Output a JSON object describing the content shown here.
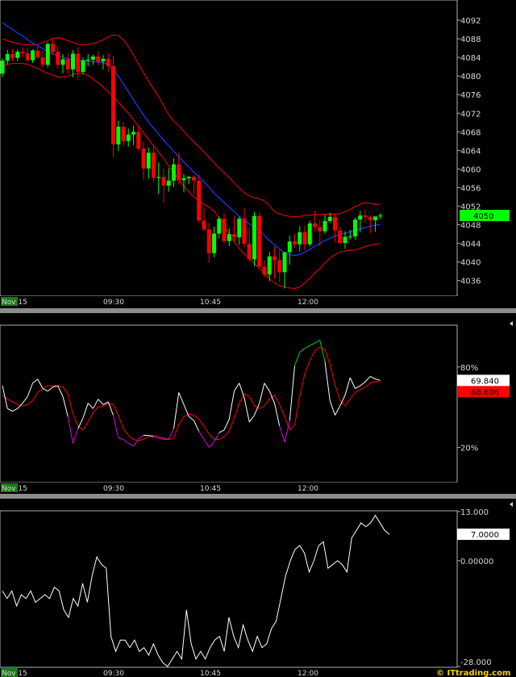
{
  "time_axis": {
    "date_badge": "Nov 15",
    "labels": [
      "09:30",
      "10:45",
      "12:00"
    ]
  },
  "watermark": "© ITtrading.com",
  "colors": {
    "up": "#00ff00",
    "down": "#ff0000",
    "band": "#ff0000",
    "ma": "#1e3cff",
    "stoch_fast": "#ffffff",
    "stoch_slow": "#ff0000",
    "stoch_overbought": "#00d000",
    "stoch_oversold": "#e000e0",
    "badge_green": "#00ff00",
    "frame": "#b0b0b0"
  },
  "chart_data": [
    {
      "type": "candlestick",
      "yticks": [
        4036,
        4040,
        4044,
        4048,
        4052,
        4056,
        4060,
        4064,
        4068,
        4072,
        4076,
        4080,
        4084,
        4088,
        4092
      ],
      "ylim": [
        4033,
        4096
      ],
      "last_price_label": "4050",
      "last_price": 4050,
      "candles": [
        [
          4080.5,
          4083.8,
          4079.8,
          4083.3
        ],
        [
          4083.3,
          4085.6,
          4082.4,
          4084.7
        ],
        [
          4084.7,
          4085.8,
          4083.2,
          4083.9
        ],
        [
          4083.9,
          4085.7,
          4083.2,
          4085.2
        ],
        [
          4085.2,
          4086.1,
          4084.2,
          4084.9
        ],
        [
          4084.9,
          4085.9,
          4083.1,
          4083.4
        ],
        [
          4083.4,
          4085.7,
          4082.8,
          4085.5
        ],
        [
          4085.5,
          4086.3,
          4083.7,
          4084.0
        ],
        [
          4084.0,
          4085.4,
          4081.9,
          4082.4
        ],
        [
          4082.4,
          4087.2,
          4081.8,
          4086.9
        ],
        [
          4086.9,
          4087.9,
          4084.5,
          4085.2
        ],
        [
          4085.2,
          4086.4,
          4081.6,
          4082.4
        ],
        [
          4082.4,
          4084.7,
          4080.6,
          4083.6
        ],
        [
          4083.6,
          4085.0,
          4080.4,
          4081.4
        ],
        [
          4081.4,
          4085.6,
          4079.7,
          4084.8
        ],
        [
          4084.8,
          4086.2,
          4079.2,
          4080.9
        ],
        [
          4080.9,
          4084.0,
          4080.3,
          4083.4
        ],
        [
          4083.4,
          4084.7,
          4082.1,
          4083.5
        ],
        [
          4083.5,
          4084.6,
          4082.4,
          4084.2
        ],
        [
          4084.2,
          4085.3,
          4082.3,
          4083.1
        ],
        [
          4083.1,
          4084.5,
          4081.4,
          4083.7
        ],
        [
          4083.7,
          4084.9,
          4080.8,
          4082.1
        ],
        [
          4082.1,
          4084.3,
          4062.5,
          4065.3
        ],
        [
          4065.3,
          4070.4,
          4063.9,
          4069.1
        ],
        [
          4069.1,
          4070.1,
          4064.9,
          4066.0
        ],
        [
          4066.0,
          4068.7,
          4064.8,
          4067.4
        ],
        [
          4067.4,
          4069.3,
          4065.1,
          4068.0
        ],
        [
          4068.0,
          4069.4,
          4063.9,
          4064.4
        ],
        [
          4064.4,
          4065.8,
          4057.7,
          4060.1
        ],
        [
          4060.1,
          4064.6,
          4057.9,
          4063.5
        ],
        [
          4063.5,
          4065.0,
          4057.3,
          4058.1
        ],
        [
          4058.1,
          4061.4,
          4054.6,
          4058.3
        ],
        [
          4058.3,
          4060.1,
          4052.7,
          4056.4
        ],
        [
          4056.4,
          4060.2,
          4055.1,
          4057.5
        ],
        [
          4057.5,
          4062.3,
          4056.1,
          4061.0
        ],
        [
          4061.0,
          4063.4,
          4056.7,
          4057.6
        ],
        [
          4057.6,
          4058.9,
          4055.0,
          4058.0
        ],
        [
          4058.0,
          4058.5,
          4056.8,
          4058.3
        ],
        [
          4058.3,
          4058.6,
          4054.6,
          4057.5
        ],
        [
          4057.5,
          4058.8,
          4048.6,
          4048.9
        ],
        [
          4048.9,
          4051.7,
          4046.6,
          4047.0
        ],
        [
          4047.0,
          4048.4,
          4039.9,
          4041.9
        ],
        [
          4041.9,
          4047.6,
          4041.0,
          4046.1
        ],
        [
          4046.1,
          4049.8,
          4045.1,
          4049.3
        ],
        [
          4049.3,
          4050.4,
          4044.0,
          4044.5
        ],
        [
          4044.5,
          4047.2,
          4043.4,
          4046.0
        ],
        [
          4046.0,
          4049.9,
          4044.1,
          4045.3
        ],
        [
          4045.3,
          4049.8,
          4043.7,
          4049.3
        ],
        [
          4049.3,
          4051.6,
          4043.2,
          4043.9
        ],
        [
          4043.9,
          4047.4,
          4040.2,
          4040.6
        ],
        [
          4040.6,
          4050.8,
          4039.1,
          4049.9
        ],
        [
          4049.9,
          4050.8,
          4038.9,
          4039.0
        ],
        [
          4039.0,
          4040.4,
          4036.7,
          4037.3
        ],
        [
          4037.3,
          4042.2,
          4035.8,
          4041.2
        ],
        [
          4041.2,
          4043.3,
          4036.4,
          4040.4
        ],
        [
          4040.4,
          4042.6,
          4035.6,
          4037.8
        ],
        [
          4037.8,
          4041.4,
          4034.3,
          4042.1
        ],
        [
          4042.1,
          4045.7,
          4039.4,
          4044.4
        ],
        [
          4044.4,
          4046.0,
          4043.1,
          4043.8
        ],
        [
          4043.8,
          4047.7,
          4042.3,
          4046.4
        ],
        [
          4046.4,
          4047.8,
          4042.5,
          4043.8
        ],
        [
          4043.8,
          4048.9,
          4043.3,
          4048.3
        ],
        [
          4048.3,
          4051.0,
          4046.6,
          4047.5
        ],
        [
          4047.5,
          4049.0,
          4043.4,
          4046.6
        ],
        [
          4046.6,
          4050.2,
          4046.0,
          4048.8
        ],
        [
          4048.8,
          4050.6,
          4048.4,
          4049.7
        ],
        [
          4049.7,
          4050.5,
          4044.2,
          4046.8
        ],
        [
          4046.8,
          4047.5,
          4043.8,
          4044.1
        ],
        [
          4044.1,
          4046.6,
          4042.8,
          4045.4
        ],
        [
          4045.4,
          4046.9,
          4044.8,
          4045.5
        ],
        [
          4045.5,
          4049.5,
          4044.8,
          4049.1
        ],
        [
          4049.1,
          4051.0,
          4046.4,
          4050.0
        ],
        [
          4050.0,
          4051.2,
          4048.4,
          4049.7
        ],
        [
          4049.7,
          4050.1,
          4046.2,
          4049.0
        ],
        [
          4049.0,
          4049.7,
          4046.5,
          4049.8
        ],
        [
          4049.8,
          4050.5,
          4049.2,
          4050.0
        ]
      ],
      "candle_format": "[open, high, low, close]",
      "ma": [
        4091.5,
        4090.7,
        4090.0,
        4089.3,
        4088.6,
        4087.8,
        4087.1,
        4086.5,
        4085.9,
        4085.2,
        4084.8,
        4084.3,
        4084.0,
        4083.7,
        4083.5,
        4083.4,
        4083.3,
        4083.2,
        4083.1,
        4083.0,
        4082.8,
        4082.5,
        4081.5,
        4080.0,
        4078.3,
        4076.6,
        4074.9,
        4073.2,
        4071.6,
        4070.1,
        4068.8,
        4067.5,
        4066.2,
        4065.0,
        4063.8,
        4062.6,
        4061.5,
        4060.4,
        4059.3,
        4058.3,
        4057.2,
        4056.1,
        4054.8,
        4053.8,
        4052.8,
        4051.8,
        4050.8,
        4049.8,
        4049.0,
        4048.2,
        4047.5,
        4046.8,
        4045.7,
        4044.6,
        4043.7,
        4042.8,
        4042.0,
        4041.6,
        4041.4,
        4041.6,
        4042.1,
        4042.7,
        4043.4,
        4044.0,
        4044.6,
        4045.1,
        4045.6,
        4045.9,
        4046.2,
        4046.5,
        4046.8,
        4047.1,
        4047.4,
        4047.7,
        4047.9,
        4048.1
      ],
      "upper_band": [
        4088.0,
        4087.6,
        4087.3,
        4087.0,
        4086.8,
        4086.7,
        4086.7,
        4086.8,
        4087.2,
        4087.6,
        4088.1,
        4088.2,
        4088.0,
        4087.6,
        4087.2,
        4086.8,
        4086.7,
        4086.8,
        4087.0,
        4087.3,
        4087.8,
        4088.4,
        4088.8,
        4088.7,
        4087.8,
        4086.3,
        4084.5,
        4082.6,
        4080.7,
        4078.9,
        4077.2,
        4075.6,
        4073.6,
        4071.7,
        4070.3,
        4069.3,
        4068.1,
        4066.9,
        4065.8,
        4064.8,
        4063.7,
        4062.5,
        4061.3,
        4060.2,
        4059.2,
        4058.1,
        4057.0,
        4055.9,
        4054.9,
        4054.2,
        4053.8,
        4053.6,
        4053.1,
        4052.1,
        4050.8,
        4050.3,
        4050.0,
        4049.8,
        4049.7,
        4049.8,
        4050.0,
        4050.1,
        4050.1,
        4050.2,
        4050.3,
        4050.3,
        4050.3,
        4050.4,
        4050.8,
        4051.3,
        4051.9,
        4052.4,
        4052.8,
        4052.6,
        4052.4,
        4052.4
      ],
      "lower_band": [
        4082.3,
        4082.5,
        4082.7,
        4082.7,
        4082.7,
        4082.5,
        4082.1,
        4081.6,
        4081.0,
        4080.6,
        4080.2,
        4079.8,
        4079.8,
        4080.0,
        4080.3,
        4080.6,
        4080.6,
        4080.1,
        4079.4,
        4078.5,
        4077.6,
        4076.6,
        4075.5,
        4074.4,
        4073.2,
        4072.0,
        4070.6,
        4069.2,
        4067.8,
        4066.4,
        4065.0,
        4063.6,
        4062.2,
        4060.7,
        4059.2,
        4057.7,
        4056.3,
        4055.1,
        4054.0,
        4053.1,
        4052.4,
        4051.8,
        4051.0,
        4049.5,
        4047.8,
        4046.0,
        4044.3,
        4042.9,
        4041.7,
        4040.7,
        4039.7,
        4038.6,
        4037.5,
        4036.4,
        4035.5,
        4034.9,
        4034.6,
        4034.4,
        4034.3,
        4034.6,
        4035.5,
        4036.5,
        4037.6,
        4038.6,
        4039.8,
        4040.8,
        4041.6,
        4042.1,
        4042.4,
        4042.5,
        4042.6,
        4042.9,
        4043.3,
        4043.6,
        4043.8,
        4044.0
      ]
    },
    {
      "type": "line",
      "yticks": [
        20,
        80
      ],
      "ytick_labels": [
        "20%",
        "80%"
      ],
      "ylim": [
        -5,
        110
      ],
      "fast_label": "69.840",
      "slow_label": "68.606",
      "fast": [
        66,
        49,
        47,
        49,
        53,
        58,
        68,
        71,
        64,
        62,
        65,
        66,
        58,
        43,
        23,
        34,
        42,
        53,
        49,
        56,
        52,
        54,
        44,
        27,
        26,
        23,
        21,
        26,
        29,
        29,
        28,
        27,
        26,
        26,
        34,
        61,
        52,
        43,
        40,
        32,
        26,
        20,
        24,
        31,
        33,
        41,
        62,
        68,
        57,
        39,
        44,
        53,
        68,
        62,
        53,
        36,
        24,
        40,
        81,
        91,
        94,
        96,
        98,
        100,
        84,
        55,
        44,
        51,
        59,
        72,
        64,
        66,
        69,
        73,
        71,
        70
      ],
      "slow": [
        59,
        56,
        54,
        52,
        51,
        52,
        55,
        61,
        64,
        66,
        66,
        66,
        65,
        60,
        45,
        36,
        33,
        39,
        46,
        50,
        51,
        53,
        52,
        44,
        34,
        29,
        26,
        25,
        26,
        28,
        29,
        28,
        27,
        26,
        27,
        37,
        43,
        45,
        44,
        41,
        36,
        30,
        26,
        26,
        28,
        32,
        42,
        53,
        60,
        58,
        51,
        49,
        51,
        56,
        59,
        52,
        43,
        33,
        37,
        58,
        75,
        85,
        92,
        95,
        93,
        82,
        67,
        55,
        51,
        56,
        61,
        63,
        65,
        68,
        69,
        69
      ]
    },
    {
      "type": "line",
      "yticks": [
        -28,
        0,
        13
      ],
      "ytick_labels": [
        "-28.000",
        "0.00000",
        "13.000"
      ],
      "ylim": [
        -28,
        13
      ],
      "last_label": "7.0000",
      "last_value": 7,
      "values": [
        -8,
        -10,
        -8,
        -12,
        -9,
        -10,
        -8,
        -11,
        -10,
        -9,
        -10,
        -7,
        -8,
        -13,
        -15,
        -10,
        -12,
        -6,
        -11,
        -4,
        1,
        -1,
        -2,
        -20,
        -24,
        -21,
        -21,
        -23,
        -21,
        -24,
        -23,
        -25,
        -22,
        -25,
        -27,
        -28,
        -26,
        -24,
        -26,
        -13,
        -22,
        -26,
        -24,
        -26,
        -23,
        -21,
        -20,
        -24,
        -15,
        -20,
        -23,
        -17,
        -21,
        -24,
        -20,
        -23,
        -22,
        -18,
        -16,
        -10,
        -4,
        0,
        3,
        4,
        2,
        -3,
        0,
        4,
        5,
        -2,
        -1,
        0,
        -1,
        -3,
        6,
        8,
        10,
        9,
        10,
        12,
        10,
        8,
        7
      ]
    }
  ]
}
